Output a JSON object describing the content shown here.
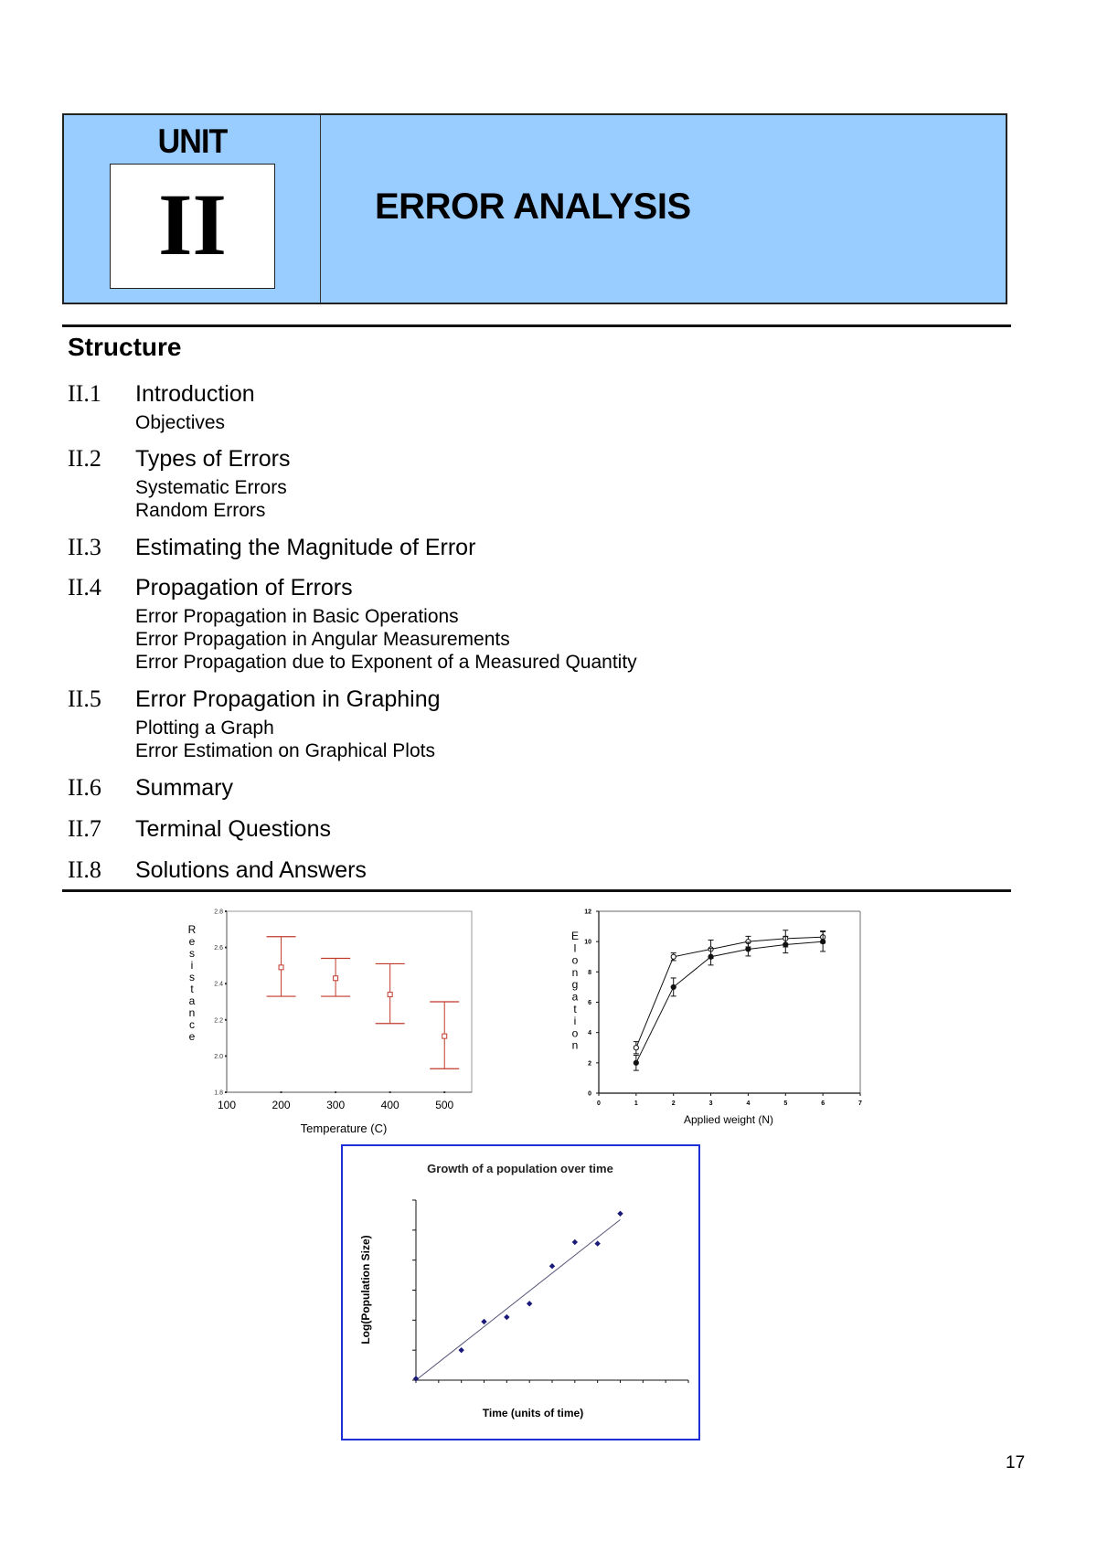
{
  "header": {
    "unit_label": "UNIT",
    "unit_number": "II",
    "title": "ERROR ANALYSIS",
    "background_color": "#99ccff"
  },
  "structure": {
    "heading": "Structure",
    "sections": [
      {
        "number": "II.1",
        "title": "Introduction",
        "subsections": [
          "Objectives"
        ]
      },
      {
        "number": "II.2",
        "title": "Types of Errors",
        "subsections": [
          "Systematic Errors",
          "Random Errors"
        ]
      },
      {
        "number": "II.3",
        "title": "Estimating the Magnitude of Error",
        "subsections": []
      },
      {
        "number": "II.4",
        "title": "Propagation of Errors",
        "subsections": [
          "Error Propagation in Basic Operations",
          "Error Propagation in Angular Measurements",
          "Error Propagation due to Exponent of a Measured Quantity"
        ]
      },
      {
        "number": "II.5",
        "title": "Error Propagation in Graphing",
        "subsections": [
          "Plotting a Graph",
          "Error Estimation on Graphical Plots"
        ]
      },
      {
        "number": "II.6",
        "title": "Summary",
        "subsections": []
      },
      {
        "number": "II.7",
        "title": "Terminal Questions",
        "subsections": []
      },
      {
        "number": "II.8",
        "title": "Solutions and Answers",
        "subsections": []
      }
    ]
  },
  "chart_data": [
    {
      "type": "scatter",
      "title": "",
      "xlabel": "Temperature (C)",
      "ylabel": "Resistance",
      "xlim": [
        100,
        550
      ],
      "ylim": [
        1.8,
        2.8
      ],
      "x_ticks": [
        "100",
        "200",
        "300",
        "400",
        "500"
      ],
      "y_ticks": [
        "1.8",
        "2.0",
        "2.2",
        "2.4",
        "2.6",
        "2.8"
      ],
      "color": "#c0392b",
      "series": [
        {
          "name": "Resistance",
          "points": [
            {
              "x": 200,
              "y": 2.49,
              "lower": 2.33,
              "upper": 2.66
            },
            {
              "x": 300,
              "y": 2.43,
              "lower": 2.33,
              "upper": 2.54
            },
            {
              "x": 400,
              "y": 2.34,
              "lower": 2.18,
              "upper": 2.51
            },
            {
              "x": 500,
              "y": 2.11,
              "lower": 1.93,
              "upper": 2.3
            }
          ]
        }
      ]
    },
    {
      "type": "line",
      "title": "",
      "xlabel": "Applied weight (N)",
      "ylabel": "Elongation",
      "xlim": [
        0,
        7
      ],
      "ylim": [
        0,
        12
      ],
      "x_ticks": [
        "0",
        "1",
        "2",
        "3",
        "4",
        "5",
        "6",
        "7"
      ],
      "y_ticks": [
        "0",
        "2",
        "4",
        "6",
        "8",
        "10",
        "12"
      ],
      "series": [
        {
          "name": "open markers",
          "marker": "open-circle",
          "x": [
            1,
            2,
            3,
            4,
            5,
            6
          ],
          "y": [
            3.0,
            9.0,
            9.5,
            10.0,
            10.2,
            10.3
          ],
          "err": [
            0.4,
            0.25,
            0.6,
            0.35,
            0.55,
            0.4
          ]
        },
        {
          "name": "filled markers",
          "marker": "filled-circle",
          "x": [
            1,
            2,
            3,
            4,
            5,
            6
          ],
          "y": [
            2.0,
            7.0,
            9.0,
            9.5,
            9.8,
            10.0
          ],
          "err": [
            0.5,
            0.6,
            0.55,
            0.45,
            0.55,
            0.65
          ]
        }
      ]
    },
    {
      "type": "scatter",
      "title": "Growth of a population over time",
      "xlabel": "Time (units of time)",
      "ylabel": "Log(Population Size)",
      "xlim": [
        0,
        12
      ],
      "ylim": [
        0,
        6
      ],
      "x_ticks": [],
      "y_ticks": [],
      "marker_color": "#1a1a7a",
      "border_color": "#1f2fd6",
      "series": [
        {
          "name": "observations",
          "x": [
            0,
            2,
            3,
            4,
            5,
            6,
            7,
            8,
            9
          ],
          "y": [
            0.05,
            1.0,
            1.95,
            2.1,
            2.55,
            3.8,
            4.6,
            4.55,
            5.55
          ]
        }
      ],
      "trendline": {
        "x": [
          0,
          9
        ],
        "y": [
          0.0,
          5.35
        ]
      }
    }
  ],
  "page_number": "17"
}
